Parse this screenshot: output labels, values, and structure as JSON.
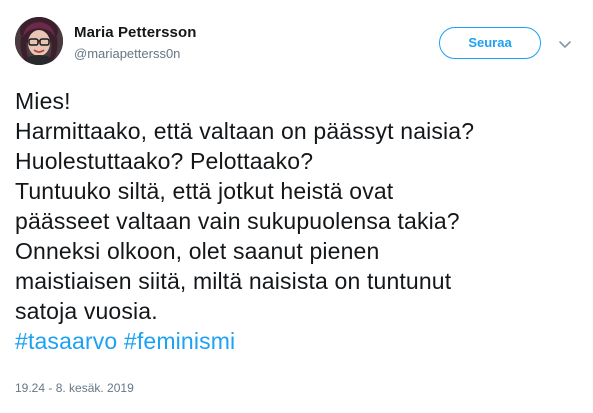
{
  "user": {
    "display_name": "Maria Pettersson",
    "handle": "@mariapetterss0n"
  },
  "actions": {
    "follow_label": "Seuraa",
    "more_icon": "chevron-down-icon"
  },
  "tweet": {
    "lines": [
      "Mies!",
      "Harmittaako, että valtaan on päässyt naisia?",
      "Huolestuttaako? Pelottaako?",
      "Tuntuuko siltä, että jotkut heistä ovat",
      "päässeet valtaan vain sukupuolensa takia?",
      "Onneksi olkoon, olet saanut pienen",
      "maistiaisen siitä, miltä naisista on tuntunut",
      "satoja vuosia."
    ],
    "hashtags": [
      "#tasaarvo",
      "#feminismi"
    ],
    "timestamp": "19.24 - 8. kesäk. 2019"
  },
  "colors": {
    "accent": "#1da1f2",
    "text": "#14171a",
    "secondary": "#657786"
  }
}
